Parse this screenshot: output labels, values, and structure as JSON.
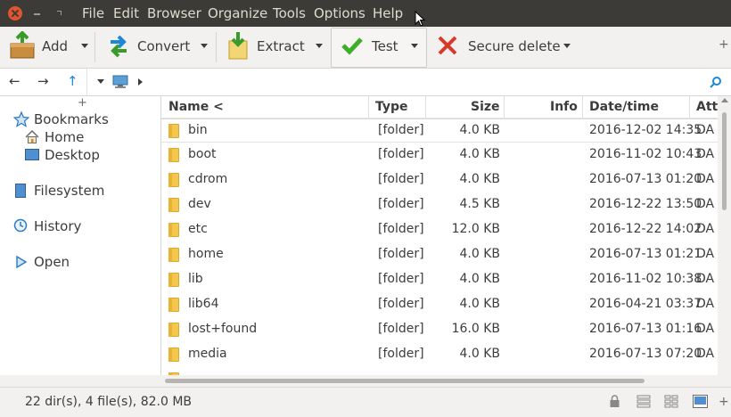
{
  "menubar": {
    "items": [
      "File",
      "Edit",
      "Browser",
      "Organize",
      "Tools",
      "Options",
      "Help"
    ]
  },
  "toolbar": {
    "add_label": "Add",
    "convert_label": "Convert",
    "extract_label": "Extract",
    "test_label": "Test",
    "secure_delete_label": "Secure delete",
    "more_label": "+"
  },
  "navbar": {
    "back": "←",
    "forward": "→",
    "up": "↑"
  },
  "sidebar": {
    "plus": "+",
    "bookmarks": "Bookmarks",
    "home": "Home",
    "desktop": "Desktop",
    "filesystem": "Filesystem",
    "history": "History",
    "open": "Open"
  },
  "table": {
    "headers": [
      "Name <",
      "Type",
      "Size",
      "Info",
      "Date/time",
      "Att"
    ],
    "rows": [
      {
        "name": "bin",
        "type": "[folder]",
        "size": "4.0 KB",
        "date": "2016-12-02 14:35",
        "attr": "DA"
      },
      {
        "name": "boot",
        "type": "[folder]",
        "size": "4.0 KB",
        "date": "2016-11-02 10:43",
        "attr": "DA"
      },
      {
        "name": "cdrom",
        "type": "[folder]",
        "size": "4.0 KB",
        "date": "2016-07-13 01:20",
        "attr": "DA"
      },
      {
        "name": "dev",
        "type": "[folder]",
        "size": "4.5 KB",
        "date": "2016-12-22 13:50",
        "attr": "DA"
      },
      {
        "name": "etc",
        "type": "[folder]",
        "size": "12.0 KB",
        "date": "2016-12-22 14:02",
        "attr": "DA"
      },
      {
        "name": "home",
        "type": "[folder]",
        "size": "4.0 KB",
        "date": "2016-07-13 01:21",
        "attr": "DA"
      },
      {
        "name": "lib",
        "type": "[folder]",
        "size": "4.0 KB",
        "date": "2016-11-02 10:38",
        "attr": "DA"
      },
      {
        "name": "lib64",
        "type": "[folder]",
        "size": "4.0 KB",
        "date": "2016-04-21 03:37",
        "attr": "DA"
      },
      {
        "name": "lost+found",
        "type": "[folder]",
        "size": "16.0 KB",
        "date": "2016-07-13 01:16",
        "attr": "DA"
      },
      {
        "name": "media",
        "type": "[folder]",
        "size": "4.0 KB",
        "date": "2016-07-13 07:20",
        "attr": "DA"
      }
    ]
  },
  "status": {
    "summary": "22 dir(s), 4 file(s), 82.0 MB",
    "plus": "+"
  },
  "colors": {
    "menubar_bg": "#3c3b37",
    "close_button": "#e2552c",
    "folder": "#f4c74f",
    "accent_blue": "#1e88d6"
  }
}
